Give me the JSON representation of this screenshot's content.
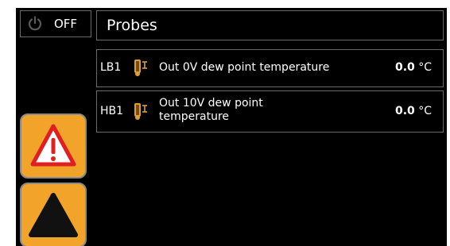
{
  "header": {
    "power_state": "OFF",
    "title": "Probes"
  },
  "probes": [
    {
      "id": "LB1",
      "icon": "temperature-probe-icon",
      "description": "Out 0V dew point temperature",
      "value": "0.0",
      "unit": "°C"
    },
    {
      "id": "HB1",
      "icon": "temperature-probe-icon",
      "description": "Out 10V dew point temperature",
      "value": "0.0",
      "unit": "°C"
    }
  ],
  "side_buttons": {
    "alarm_icon": "warning-icon",
    "up_icon": "triangle-up-icon"
  },
  "colors": {
    "background": "#000000",
    "border": "#6a6a6a",
    "button": "#f2a42a",
    "warning": "#e02020",
    "probe_icon": "#d9a035"
  }
}
